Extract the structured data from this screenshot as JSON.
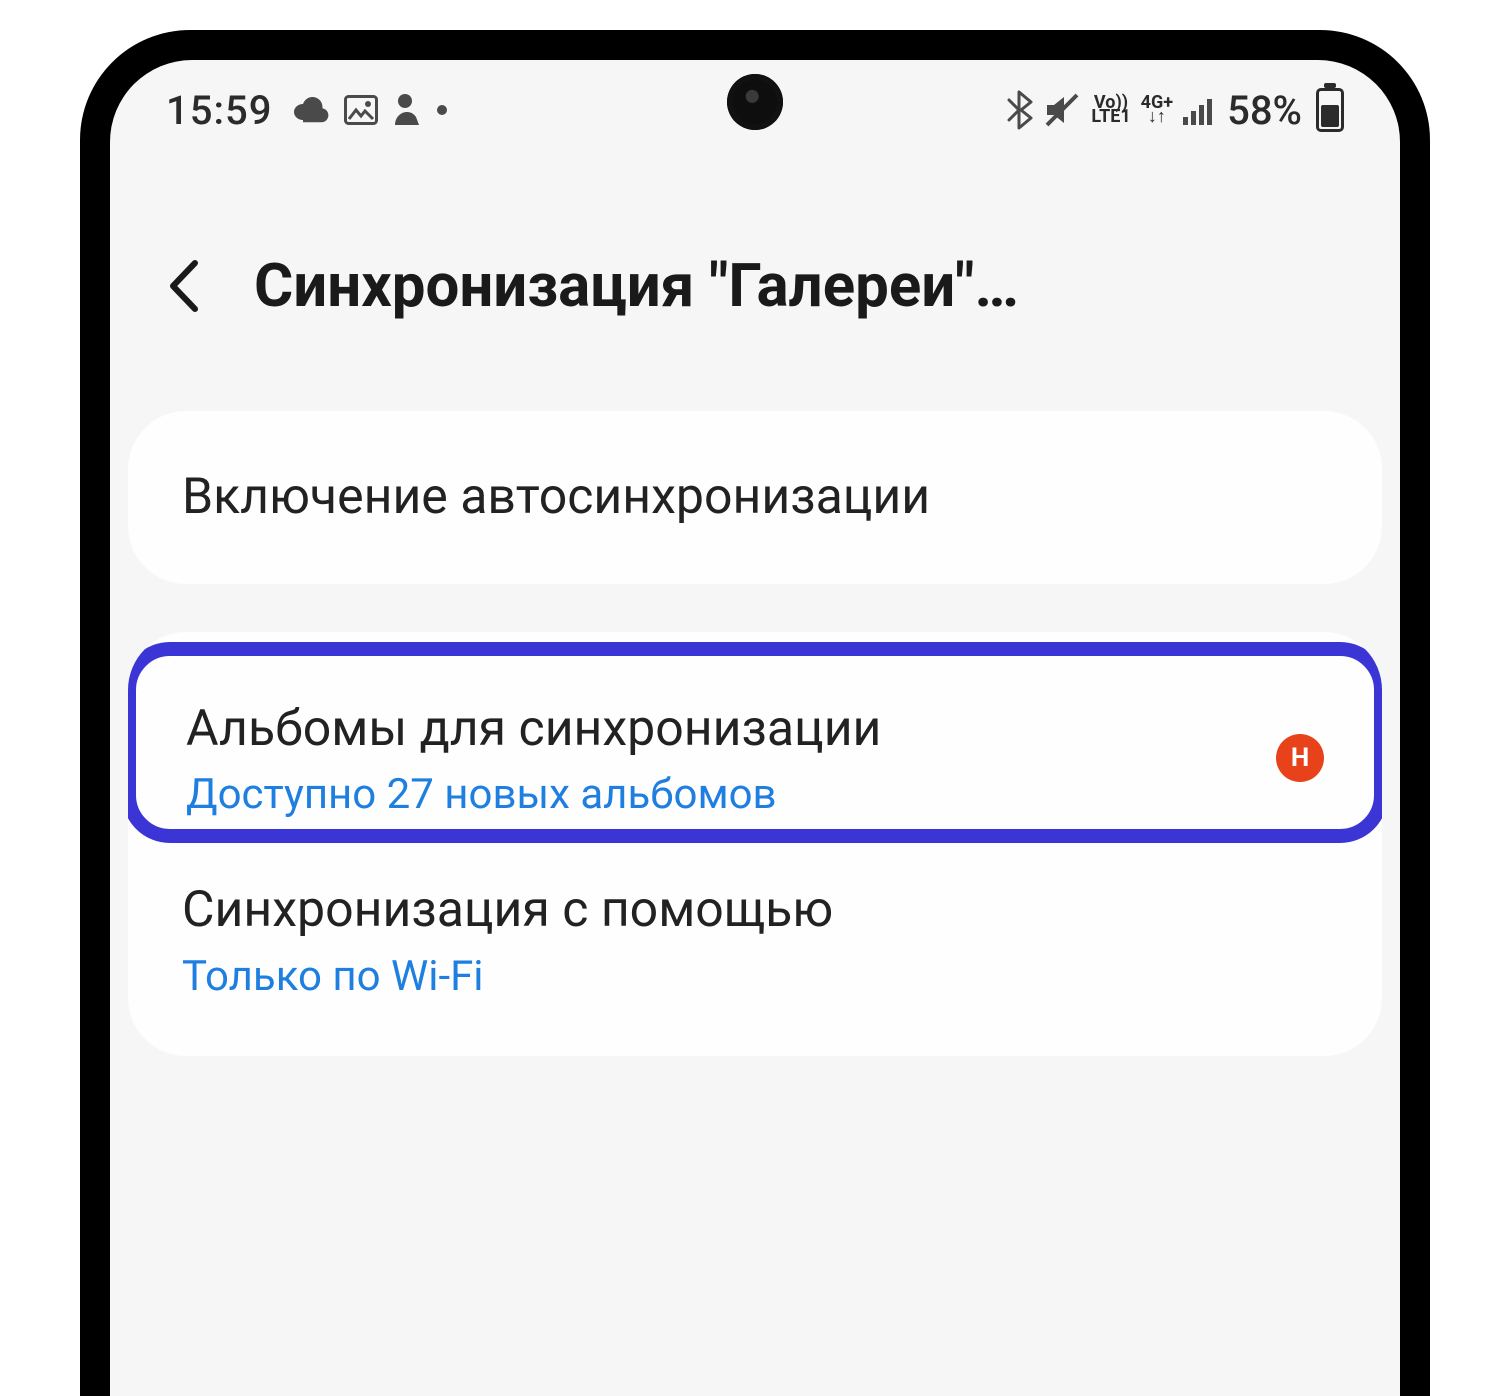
{
  "status": {
    "time": "15:59",
    "battery_text": "58%",
    "lte_top": "Vo))",
    "lte_bottom": "LTE1",
    "net_top": "4G+",
    "net_arrows": "↓↑"
  },
  "header": {
    "title": "Синхронизация \"Галереи\"…"
  },
  "card1": {
    "autosync_label": "Включение автосинхронизации"
  },
  "card2": {
    "albums_title": "Альбомы для синхронизации",
    "albums_sub": "Доступно 27 новых альбомов",
    "badge": "Н",
    "sync_via_title": "Синхронизация с помощью",
    "sync_via_sub": "Только по Wi-Fi"
  },
  "icons": {
    "cloud": "cloud-icon",
    "image": "image-icon",
    "person": "person-icon",
    "dot": "dot-icon",
    "bluetooth": "bluetooth-icon",
    "mute": "mute-icon",
    "signal": "signal-icon",
    "back": "chevron-left-icon"
  }
}
